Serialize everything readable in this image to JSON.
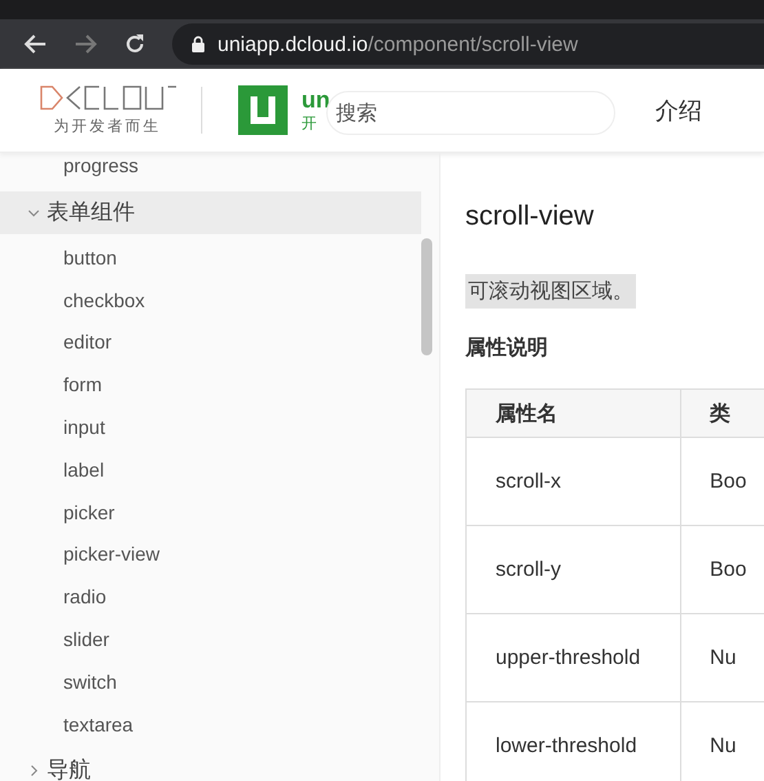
{
  "browser": {
    "url_host": "uniapp.dcloud.io",
    "url_path": "/component/scroll-view"
  },
  "header": {
    "logo_text": "为开发者而生",
    "brand_title": "un",
    "brand_subtitle": "开",
    "search": {
      "placeholder": "搜索"
    },
    "nav": [
      "介绍"
    ]
  },
  "sidebar": {
    "items": [
      {
        "label": "progress",
        "kind": "leaf"
      },
      {
        "label": "表单组件",
        "kind": "group",
        "expanded": true,
        "selected": true,
        "children": [
          {
            "label": "button"
          },
          {
            "label": "checkbox"
          },
          {
            "label": "editor"
          },
          {
            "label": "form"
          },
          {
            "label": "input"
          },
          {
            "label": "label"
          },
          {
            "label": "picker"
          },
          {
            "label": "picker-view"
          },
          {
            "label": "radio"
          },
          {
            "label": "slider"
          },
          {
            "label": "switch"
          },
          {
            "label": "textarea"
          }
        ]
      },
      {
        "label": "导航",
        "kind": "group",
        "expanded": false,
        "selected": false
      }
    ]
  },
  "content": {
    "title": "scroll-view",
    "description": "可滚动视图区域。",
    "section": "属性说明",
    "table": {
      "columns": [
        "属性名",
        "类"
      ],
      "rows": [
        [
          "scroll-x",
          "Boo"
        ],
        [
          "scroll-y",
          "Boo"
        ],
        [
          "upper-threshold",
          "Nu"
        ],
        [
          "lower-threshold",
          "Nu"
        ]
      ]
    }
  }
}
